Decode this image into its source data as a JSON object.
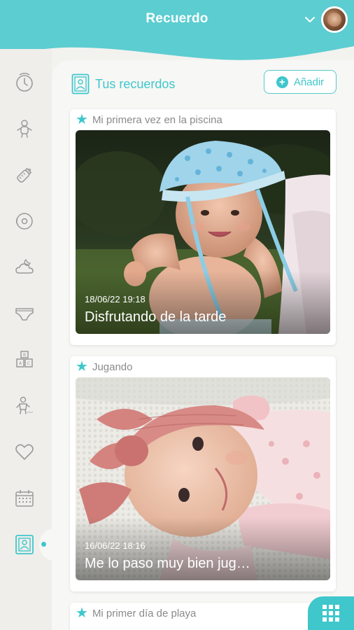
{
  "app": {
    "title": "Recuerdo"
  },
  "colors": {
    "accent": "#3fc7cc",
    "header": "#5ccdd0",
    "sidebar": "#efeeea",
    "content": "#f7f7f5"
  },
  "header": {
    "dropdown_icon": "chevron-down-icon",
    "avatar_icon": "profile-avatar"
  },
  "sidebar": {
    "items": [
      {
        "name": "timer",
        "icon": "clock-icon"
      },
      {
        "name": "growth",
        "icon": "baby-body-icon"
      },
      {
        "name": "bottle",
        "icon": "baby-bottle-icon"
      },
      {
        "name": "pumping",
        "icon": "breast-pump-icon"
      },
      {
        "name": "sleep",
        "icon": "moon-cloud-icon"
      },
      {
        "name": "diaper",
        "icon": "diaper-icon"
      },
      {
        "name": "activities",
        "icon": "toy-blocks-icon"
      },
      {
        "name": "milestones",
        "icon": "baby-milestone-icon"
      },
      {
        "name": "health",
        "icon": "heart-icon"
      },
      {
        "name": "calendar",
        "icon": "calendar-icon"
      },
      {
        "name": "memories",
        "icon": "photo-frame-icon",
        "active": true
      }
    ]
  },
  "main": {
    "section_title": "Tus recuerdos",
    "add_button": "Añadir"
  },
  "memories": [
    {
      "title": "Mi primera vez en la piscina",
      "date": "18/06/22 19:18",
      "caption": "Disfrutando de la tarde"
    },
    {
      "title": "Jugando",
      "date": "16/06/22 18:16",
      "caption": "Me lo paso muy bien jug…"
    },
    {
      "title": "Mi primer día de playa"
    }
  ],
  "fab": {
    "icon": "grid-menu-icon"
  }
}
